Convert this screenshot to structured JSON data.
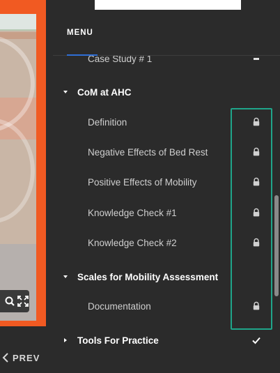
{
  "slide": {
    "prev_label": "PREV"
  },
  "menu": {
    "tab_label": "MENU",
    "items": [
      {
        "type": "item",
        "label": "Case Study # 1",
        "status": "partial"
      },
      {
        "type": "section",
        "label": "CoM at AHC",
        "expanded": true,
        "status": "none"
      },
      {
        "type": "item",
        "label": "Definition",
        "status": "locked"
      },
      {
        "type": "item",
        "label": "Negative Effects of Bed Rest",
        "status": "locked"
      },
      {
        "type": "item",
        "label": "Positive Effects of Mobility",
        "status": "locked"
      },
      {
        "type": "item",
        "label": "Knowledge Check #1",
        "status": "locked"
      },
      {
        "type": "item",
        "label": "Knowledge Check #2",
        "status": "locked"
      },
      {
        "type": "section",
        "label": "Scales for Mobility Assessment",
        "expanded": true,
        "status": "none"
      },
      {
        "type": "item",
        "label": "Documentation",
        "status": "locked"
      },
      {
        "type": "section",
        "label": "Tools For Practice",
        "expanded": false,
        "status": "complete"
      }
    ]
  },
  "colors": {
    "slide_frame": "#f15a22",
    "highlight": "#1fa58a",
    "tab_underline": "#2f6fd6",
    "panel_bg": "#2b2b2b"
  }
}
